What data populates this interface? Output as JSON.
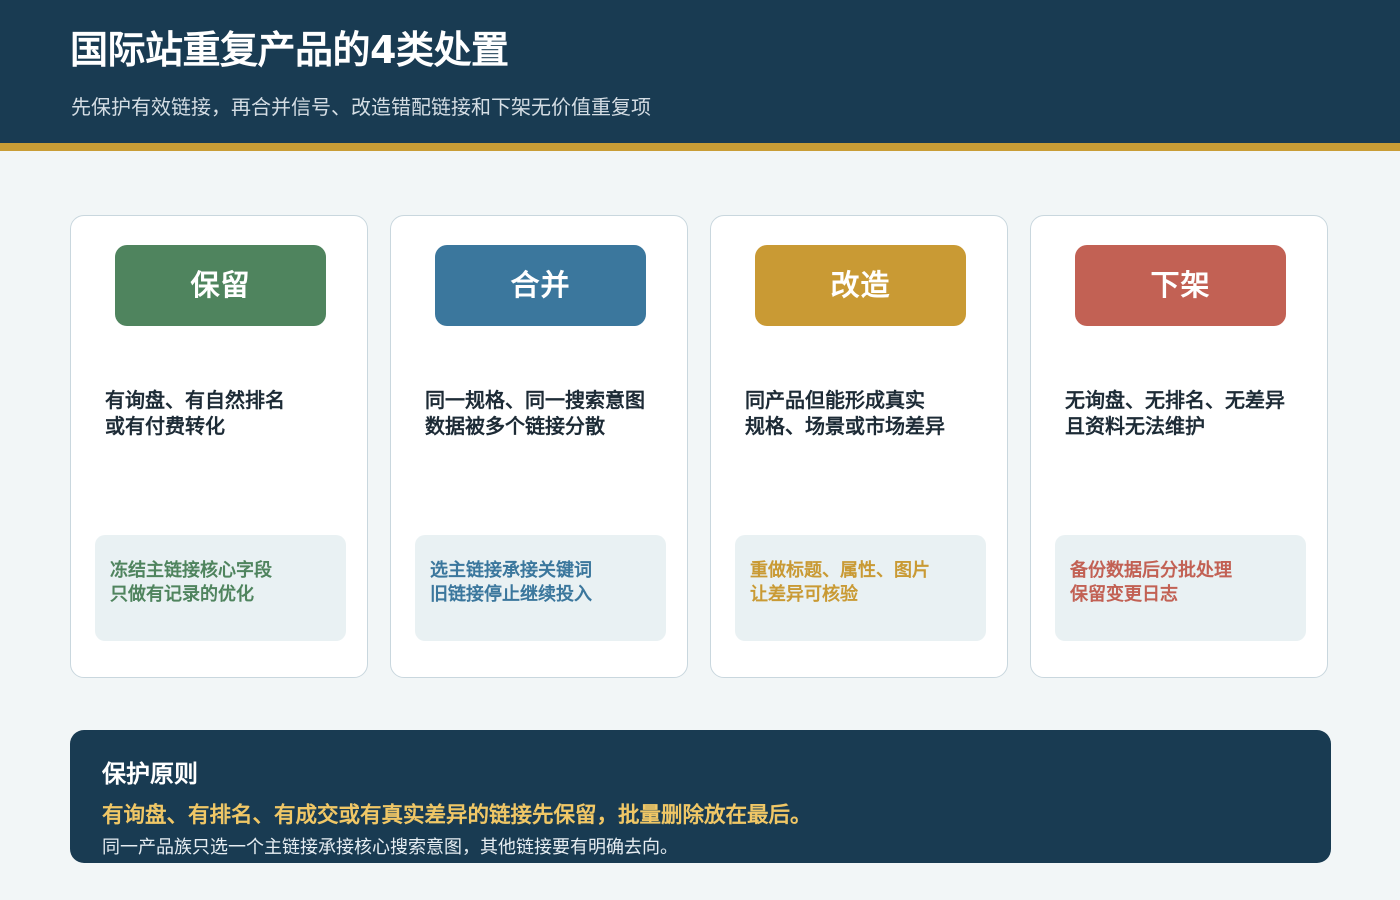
{
  "header": {
    "title": "国际站重复产品的4类处置",
    "subtitle": "先保护有效链接，再合并信号、改造错配链接和下架无价值重复项"
  },
  "colors": {
    "navy": "#193b52",
    "gold_bar": "#c99d36",
    "keep": "#4f845e",
    "merge": "#3b779d",
    "rework": "#c99a34",
    "delist": "#c26154",
    "highlight": "#f0c766"
  },
  "cards": [
    {
      "label": "保留",
      "condition": "有询盘、有自然排名\n或有付费转化",
      "action": "冻结主链接核心字段\n只做有记录的优化"
    },
    {
      "label": "合并",
      "condition": "同一规格、同一搜索意图\n数据被多个链接分散",
      "action": "选主链接承接关键词\n旧链接停止继续投入"
    },
    {
      "label": "改造",
      "condition": "同产品但能形成真实\n规格、场景或市场差异",
      "action": "重做标题、属性、图片\n让差异可核验"
    },
    {
      "label": "下架",
      "condition": "无询盘、无排名、无差异\n且资料无法维护",
      "action": "备份数据后分批处理\n保留变更日志"
    }
  ],
  "principle": {
    "title": "保护原则",
    "highlight": "有询盘、有排名、有成交或有真实差异的链接先保留，批量删除放在最后。",
    "note": "同一产品族只选一个主链接承接核心搜索意图，其他链接要有明确去向。"
  }
}
